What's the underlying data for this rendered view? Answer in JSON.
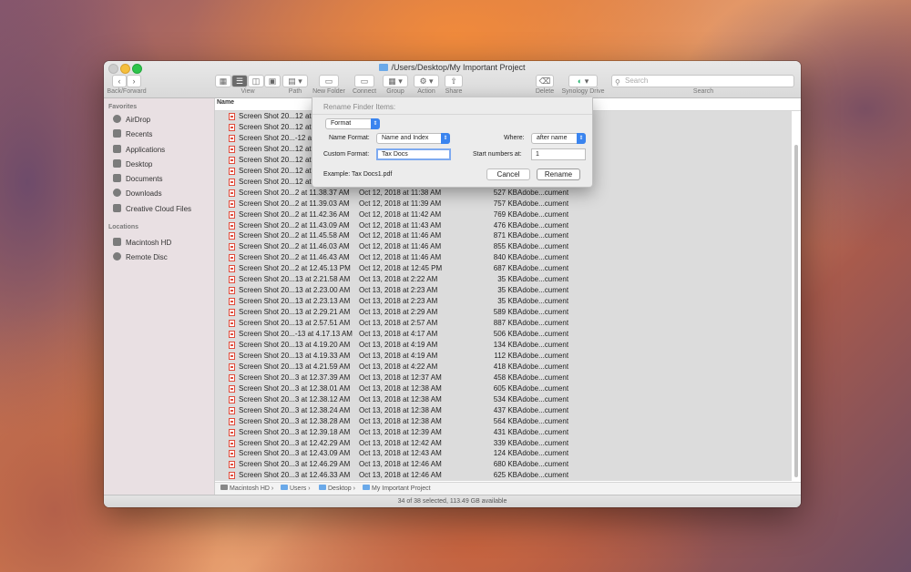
{
  "window": {
    "title": "/Users/Desktop/My Important Project"
  },
  "toolbar": {
    "back_forward_label": "Back/Forward",
    "view_label": "View",
    "path_label": "Path",
    "new_folder_label": "New Folder",
    "connect_label": "Connect",
    "group_label": "Group",
    "action_label": "Action",
    "share_label": "Share",
    "delete_label": "Delete",
    "synology_label": "Synology Drive",
    "search_label": "Search",
    "search_placeholder": "Search"
  },
  "sidebar": {
    "favorites_header": "Favorites",
    "favorites": [
      {
        "label": "AirDrop",
        "icon": "airdrop-icon"
      },
      {
        "label": "Recents",
        "icon": "recents-icon"
      },
      {
        "label": "Applications",
        "icon": "applications-icon"
      },
      {
        "label": "Desktop",
        "icon": "desktop-icon"
      },
      {
        "label": "Documents",
        "icon": "documents-icon"
      },
      {
        "label": "Downloads",
        "icon": "downloads-icon"
      },
      {
        "label": "Creative Cloud Files",
        "icon": "creative-cloud-icon"
      }
    ],
    "locations_header": "Locations",
    "locations": [
      {
        "label": "Macintosh HD",
        "icon": "hard-drive-icon"
      },
      {
        "label": "Remote Disc",
        "icon": "remote-disc-icon"
      }
    ]
  },
  "columns": {
    "name": "Name"
  },
  "files": [
    {
      "name": "Screen Shot 20...12 at",
      "date": "",
      "size": "",
      "kind": ""
    },
    {
      "name": "Screen Shot 20...12 at",
      "date": "",
      "size": "",
      "kind": ""
    },
    {
      "name": "Screen Shot 20...-12 at",
      "date": "",
      "size": "",
      "kind": ""
    },
    {
      "name": "Screen Shot 20...12 at",
      "date": "",
      "size": "",
      "kind": ""
    },
    {
      "name": "Screen Shot 20...12 at",
      "date": "",
      "size": "",
      "kind": ""
    },
    {
      "name": "Screen Shot 20...12 at",
      "date": "",
      "size": "",
      "kind": ""
    },
    {
      "name": "Screen Shot 20...12 at",
      "date": "",
      "size": "",
      "kind": ""
    },
    {
      "name": "Screen Shot 20...2 at 11.38.37 AM",
      "date": "Oct 12, 2018 at 11:38 AM",
      "size": "527 KB",
      "kind": "Adobe...cument"
    },
    {
      "name": "Screen Shot 20...2 at 11.39.03 AM",
      "date": "Oct 12, 2018 at 11:39 AM",
      "size": "757 KB",
      "kind": "Adobe...cument"
    },
    {
      "name": "Screen Shot 20...2 at 11.42.36 AM",
      "date": "Oct 12, 2018 at 11:42 AM",
      "size": "769 KB",
      "kind": "Adobe...cument"
    },
    {
      "name": "Screen Shot 20...2 at 11.43.09 AM",
      "date": "Oct 12, 2018 at 11:43 AM",
      "size": "476 KB",
      "kind": "Adobe...cument"
    },
    {
      "name": "Screen Shot 20...2 at 11.45.58 AM",
      "date": "Oct 12, 2018 at 11:46 AM",
      "size": "871 KB",
      "kind": "Adobe...cument"
    },
    {
      "name": "Screen Shot 20...2 at 11.46.03 AM",
      "date": "Oct 12, 2018 at 11:46 AM",
      "size": "855 KB",
      "kind": "Adobe...cument"
    },
    {
      "name": "Screen Shot 20...2 at 11.46.43 AM",
      "date": "Oct 12, 2018 at 11:46 AM",
      "size": "840 KB",
      "kind": "Adobe...cument"
    },
    {
      "name": "Screen Shot 20...2 at 12.45.13 PM",
      "date": "Oct 12, 2018 at 12:45 PM",
      "size": "687 KB",
      "kind": "Adobe...cument"
    },
    {
      "name": "Screen Shot 20...13 at 2.21.58 AM",
      "date": "Oct 13, 2018 at 2:22 AM",
      "size": "35 KB",
      "kind": "Adobe...cument"
    },
    {
      "name": "Screen Shot 20...13 at 2.23.00 AM",
      "date": "Oct 13, 2018 at 2:23 AM",
      "size": "35 KB",
      "kind": "Adobe...cument"
    },
    {
      "name": "Screen Shot 20...13 at 2.23.13 AM",
      "date": "Oct 13, 2018 at 2:23 AM",
      "size": "35 KB",
      "kind": "Adobe...cument"
    },
    {
      "name": "Screen Shot 20...13 at 2.29.21 AM",
      "date": "Oct 13, 2018 at 2:29 AM",
      "size": "589 KB",
      "kind": "Adobe...cument"
    },
    {
      "name": "Screen Shot 20...13 at 2.57.51 AM",
      "date": "Oct 13, 2018 at 2:57 AM",
      "size": "887 KB",
      "kind": "Adobe...cument"
    },
    {
      "name": "Screen Shot 20...-13 at 4.17.13 AM",
      "date": "Oct 13, 2018 at 4:17 AM",
      "size": "506 KB",
      "kind": "Adobe...cument"
    },
    {
      "name": "Screen Shot 20...13 at 4.19.20 AM",
      "date": "Oct 13, 2018 at 4:19 AM",
      "size": "134 KB",
      "kind": "Adobe...cument"
    },
    {
      "name": "Screen Shot 20...13 at 4.19.33 AM",
      "date": "Oct 13, 2018 at 4:19 AM",
      "size": "112 KB",
      "kind": "Adobe...cument"
    },
    {
      "name": "Screen Shot 20...13 at 4.21.59 AM",
      "date": "Oct 13, 2018 at 4:22 AM",
      "size": "418 KB",
      "kind": "Adobe...cument"
    },
    {
      "name": "Screen Shot 20...3 at 12.37.39 AM",
      "date": "Oct 13, 2018 at 12:37 AM",
      "size": "458 KB",
      "kind": "Adobe...cument"
    },
    {
      "name": "Screen Shot 20...3 at 12.38.01 AM",
      "date": "Oct 13, 2018 at 12:38 AM",
      "size": "605 KB",
      "kind": "Adobe...cument"
    },
    {
      "name": "Screen Shot 20...3 at 12.38.12 AM",
      "date": "Oct 13, 2018 at 12:38 AM",
      "size": "534 KB",
      "kind": "Adobe...cument"
    },
    {
      "name": "Screen Shot 20...3 at 12.38.24 AM",
      "date": "Oct 13, 2018 at 12:38 AM",
      "size": "437 KB",
      "kind": "Adobe...cument"
    },
    {
      "name": "Screen Shot 20...3 at 12.38.28 AM",
      "date": "Oct 13, 2018 at 12:38 AM",
      "size": "564 KB",
      "kind": "Adobe...cument"
    },
    {
      "name": "Screen Shot 20...3 at 12.39.18 AM",
      "date": "Oct 13, 2018 at 12:39 AM",
      "size": "431 KB",
      "kind": "Adobe...cument"
    },
    {
      "name": "Screen Shot 20...3 at 12.42.29 AM",
      "date": "Oct 13, 2018 at 12:42 AM",
      "size": "339 KB",
      "kind": "Adobe...cument"
    },
    {
      "name": "Screen Shot 20...3 at 12.43.09 AM",
      "date": "Oct 13, 2018 at 12:43 AM",
      "size": "124 KB",
      "kind": "Adobe...cument"
    },
    {
      "name": "Screen Shot 20...3 at 12.46.29 AM",
      "date": "Oct 13, 2018 at 12:46 AM",
      "size": "680 KB",
      "kind": "Adobe...cument"
    },
    {
      "name": "Screen Shot 20...3 at 12.46.33 AM",
      "date": "Oct 13, 2018 at 12:46 AM",
      "size": "625 KB",
      "kind": "Adobe...cument"
    }
  ],
  "pathbar": [
    {
      "label": "Macintosh HD",
      "icon": "hard-drive-icon"
    },
    {
      "label": "Users",
      "icon": "folder-icon"
    },
    {
      "label": "Desktop",
      "icon": "folder-icon"
    },
    {
      "label": "My Important Project",
      "icon": "folder-icon"
    }
  ],
  "status": "34 of 38 selected, 113.49 GB available",
  "rename_dialog": {
    "title": "Rename Finder Items:",
    "mode": "Format",
    "name_format_label": "Name Format:",
    "name_format_value": "Name and Index",
    "where_label": "Where:",
    "where_value": "after name",
    "custom_format_label": "Custom Format:",
    "custom_format_value": "Tax Docs",
    "start_numbers_label": "Start numbers at:",
    "start_numbers_value": "1",
    "example": "Example: Tax Docs1.pdf",
    "cancel_label": "Cancel",
    "rename_label": "Rename"
  },
  "colors": {
    "accent": "#3a84ef",
    "selected_row": "#dcdcdc",
    "pdf_icon": "#e04c3c",
    "folder": "#6aa9e9"
  }
}
